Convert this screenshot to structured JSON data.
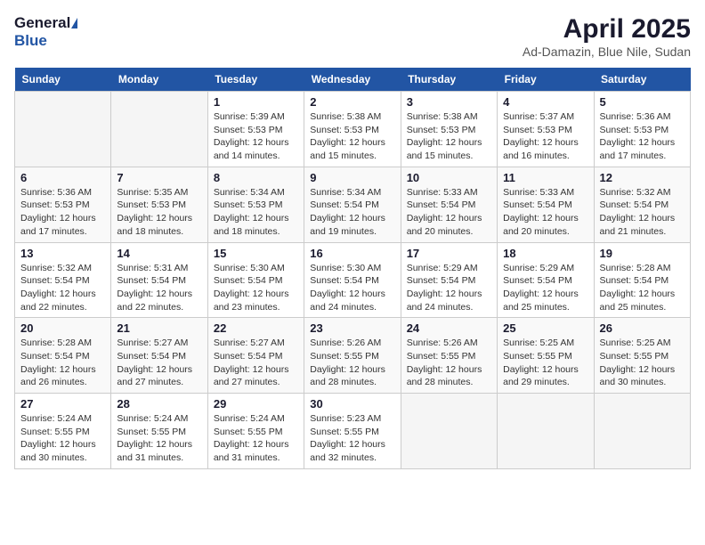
{
  "header": {
    "logo_general": "General",
    "logo_blue": "Blue",
    "month_title": "April 2025",
    "location": "Ad-Damazin, Blue Nile, Sudan"
  },
  "days_of_week": [
    "Sunday",
    "Monday",
    "Tuesday",
    "Wednesday",
    "Thursday",
    "Friday",
    "Saturday"
  ],
  "weeks": [
    [
      {
        "day": "",
        "info": ""
      },
      {
        "day": "",
        "info": ""
      },
      {
        "day": "1",
        "info": "Sunrise: 5:39 AM\nSunset: 5:53 PM\nDaylight: 12 hours\nand 14 minutes."
      },
      {
        "day": "2",
        "info": "Sunrise: 5:38 AM\nSunset: 5:53 PM\nDaylight: 12 hours\nand 15 minutes."
      },
      {
        "day": "3",
        "info": "Sunrise: 5:38 AM\nSunset: 5:53 PM\nDaylight: 12 hours\nand 15 minutes."
      },
      {
        "day": "4",
        "info": "Sunrise: 5:37 AM\nSunset: 5:53 PM\nDaylight: 12 hours\nand 16 minutes."
      },
      {
        "day": "5",
        "info": "Sunrise: 5:36 AM\nSunset: 5:53 PM\nDaylight: 12 hours\nand 17 minutes."
      }
    ],
    [
      {
        "day": "6",
        "info": "Sunrise: 5:36 AM\nSunset: 5:53 PM\nDaylight: 12 hours\nand 17 minutes."
      },
      {
        "day": "7",
        "info": "Sunrise: 5:35 AM\nSunset: 5:53 PM\nDaylight: 12 hours\nand 18 minutes."
      },
      {
        "day": "8",
        "info": "Sunrise: 5:34 AM\nSunset: 5:53 PM\nDaylight: 12 hours\nand 18 minutes."
      },
      {
        "day": "9",
        "info": "Sunrise: 5:34 AM\nSunset: 5:54 PM\nDaylight: 12 hours\nand 19 minutes."
      },
      {
        "day": "10",
        "info": "Sunrise: 5:33 AM\nSunset: 5:54 PM\nDaylight: 12 hours\nand 20 minutes."
      },
      {
        "day": "11",
        "info": "Sunrise: 5:33 AM\nSunset: 5:54 PM\nDaylight: 12 hours\nand 20 minutes."
      },
      {
        "day": "12",
        "info": "Sunrise: 5:32 AM\nSunset: 5:54 PM\nDaylight: 12 hours\nand 21 minutes."
      }
    ],
    [
      {
        "day": "13",
        "info": "Sunrise: 5:32 AM\nSunset: 5:54 PM\nDaylight: 12 hours\nand 22 minutes."
      },
      {
        "day": "14",
        "info": "Sunrise: 5:31 AM\nSunset: 5:54 PM\nDaylight: 12 hours\nand 22 minutes."
      },
      {
        "day": "15",
        "info": "Sunrise: 5:30 AM\nSunset: 5:54 PM\nDaylight: 12 hours\nand 23 minutes."
      },
      {
        "day": "16",
        "info": "Sunrise: 5:30 AM\nSunset: 5:54 PM\nDaylight: 12 hours\nand 24 minutes."
      },
      {
        "day": "17",
        "info": "Sunrise: 5:29 AM\nSunset: 5:54 PM\nDaylight: 12 hours\nand 24 minutes."
      },
      {
        "day": "18",
        "info": "Sunrise: 5:29 AM\nSunset: 5:54 PM\nDaylight: 12 hours\nand 25 minutes."
      },
      {
        "day": "19",
        "info": "Sunrise: 5:28 AM\nSunset: 5:54 PM\nDaylight: 12 hours\nand 25 minutes."
      }
    ],
    [
      {
        "day": "20",
        "info": "Sunrise: 5:28 AM\nSunset: 5:54 PM\nDaylight: 12 hours\nand 26 minutes."
      },
      {
        "day": "21",
        "info": "Sunrise: 5:27 AM\nSunset: 5:54 PM\nDaylight: 12 hours\nand 27 minutes."
      },
      {
        "day": "22",
        "info": "Sunrise: 5:27 AM\nSunset: 5:54 PM\nDaylight: 12 hours\nand 27 minutes."
      },
      {
        "day": "23",
        "info": "Sunrise: 5:26 AM\nSunset: 5:55 PM\nDaylight: 12 hours\nand 28 minutes."
      },
      {
        "day": "24",
        "info": "Sunrise: 5:26 AM\nSunset: 5:55 PM\nDaylight: 12 hours\nand 28 minutes."
      },
      {
        "day": "25",
        "info": "Sunrise: 5:25 AM\nSunset: 5:55 PM\nDaylight: 12 hours\nand 29 minutes."
      },
      {
        "day": "26",
        "info": "Sunrise: 5:25 AM\nSunset: 5:55 PM\nDaylight: 12 hours\nand 30 minutes."
      }
    ],
    [
      {
        "day": "27",
        "info": "Sunrise: 5:24 AM\nSunset: 5:55 PM\nDaylight: 12 hours\nand 30 minutes."
      },
      {
        "day": "28",
        "info": "Sunrise: 5:24 AM\nSunset: 5:55 PM\nDaylight: 12 hours\nand 31 minutes."
      },
      {
        "day": "29",
        "info": "Sunrise: 5:24 AM\nSunset: 5:55 PM\nDaylight: 12 hours\nand 31 minutes."
      },
      {
        "day": "30",
        "info": "Sunrise: 5:23 AM\nSunset: 5:55 PM\nDaylight: 12 hours\nand 32 minutes."
      },
      {
        "day": "",
        "info": ""
      },
      {
        "day": "",
        "info": ""
      },
      {
        "day": "",
        "info": ""
      }
    ]
  ]
}
